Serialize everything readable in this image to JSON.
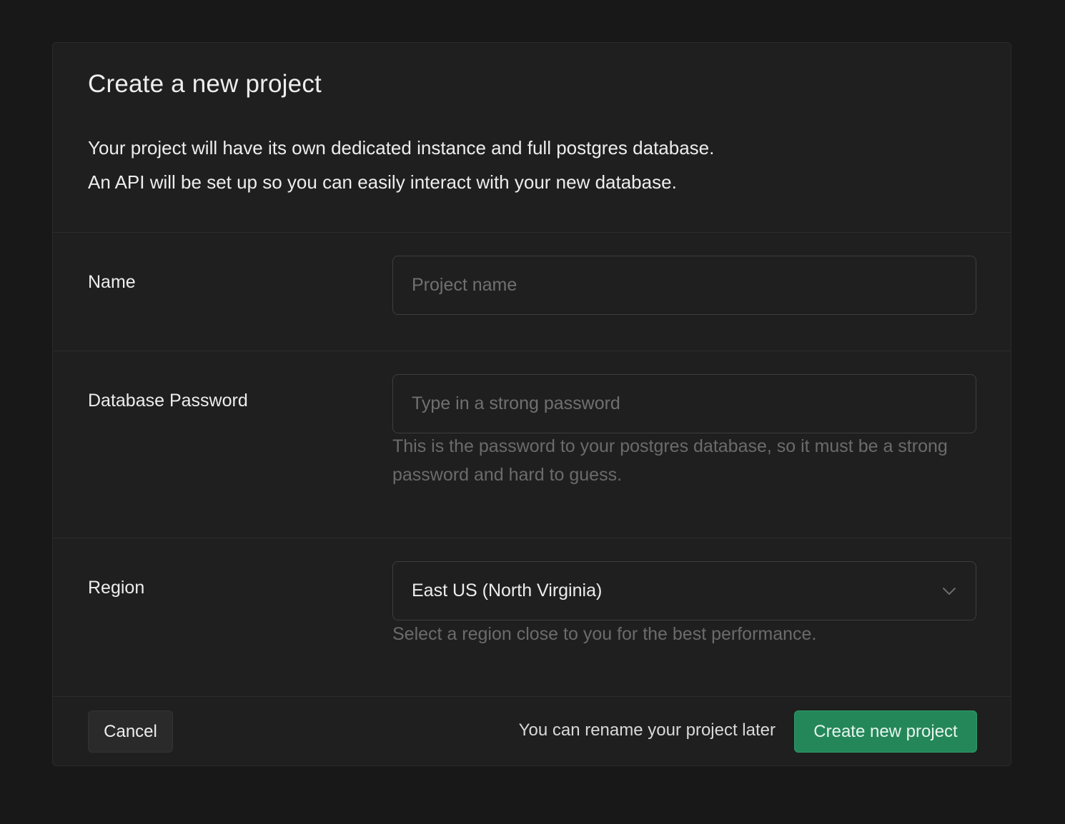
{
  "dialog": {
    "title": "Create a new project",
    "description_line1": "Your project will have its own dedicated instance and full postgres database.",
    "description_line2": "An API will be set up so you can easily interact with your new database."
  },
  "form": {
    "name": {
      "label": "Name",
      "value": "",
      "placeholder": "Project name"
    },
    "password": {
      "label": "Database Password",
      "value": "",
      "placeholder": "Type in a strong password",
      "help": "This is the password to your postgres database, so it must be a strong password and hard to guess."
    },
    "region": {
      "label": "Region",
      "selected": "East US (North Virginia)",
      "help": "Select a region close to you for the best performance.",
      "icon": "chevron-down-icon"
    }
  },
  "footer": {
    "cancel_label": "Cancel",
    "note": "You can rename your project later",
    "create_label": "Create new project"
  },
  "colors": {
    "background": "#181818",
    "panel": "#1f1f1f",
    "accent": "#24875a"
  }
}
